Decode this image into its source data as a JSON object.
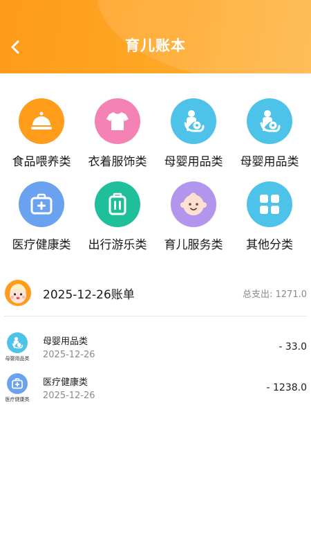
{
  "header": {
    "title": "育儿账本"
  },
  "categories": [
    {
      "label": "食品喂养类",
      "icon": "food-cloche-icon",
      "color": "#ff9c1a"
    },
    {
      "label": "衣着服饰类",
      "icon": "tshirt-icon",
      "color": "#f582b4"
    },
    {
      "label": "母婴用品类",
      "icon": "mother-baby-icon",
      "color": "#4ec3e9"
    },
    {
      "label": "母婴用品类",
      "icon": "mother-baby-icon",
      "color": "#4ec3e9"
    },
    {
      "label": "医疗健康类",
      "icon": "medical-kit-icon",
      "color": "#6aa2ef"
    },
    {
      "label": "出行游乐类",
      "icon": "luggage-icon",
      "color": "#1fbf9a"
    },
    {
      "label": "育儿服务类",
      "icon": "baby-face-icon",
      "color": "#b296ee"
    },
    {
      "label": "其他分类",
      "icon": "grid-apps-icon",
      "color": "#4ec3e9"
    }
  ],
  "bill": {
    "title": "2025-12-26账单",
    "total": "总支出: 1271.0"
  },
  "records": [
    {
      "icon_label": "母婴用品类",
      "name": "母婴用品类",
      "date": "2025-12-26",
      "amount": "- 33.0",
      "icon": "mother-baby-icon",
      "color": "#4ec3e9"
    },
    {
      "icon_label": "医疗健康类",
      "name": "医疗健康类",
      "date": "2025-12-26",
      "amount": "- 1238.0",
      "icon": "medical-kit-icon",
      "color": "#6aa2ef"
    }
  ]
}
